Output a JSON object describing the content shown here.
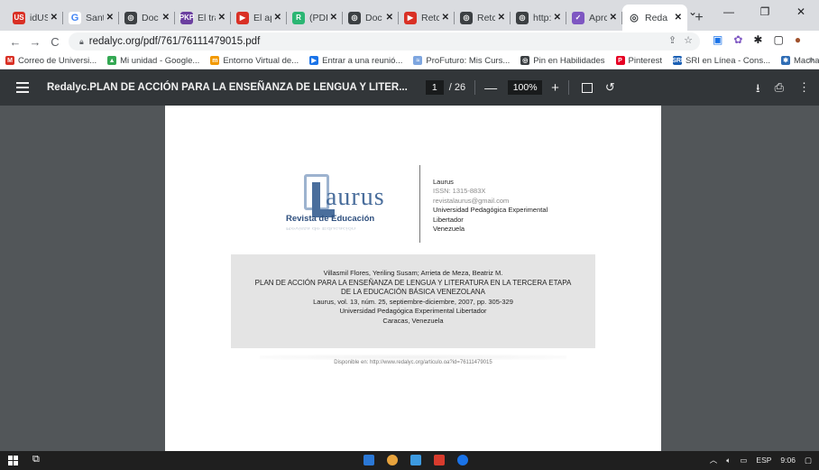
{
  "browser": {
    "tabs": [
      {
        "label": "idUS",
        "favicon_color": "#d93025",
        "favicon_text": "US"
      },
      {
        "label": "Sant",
        "favicon_color": "#ffffff",
        "favicon_text": "G"
      },
      {
        "label": "Doc",
        "favicon_color": "#3c4043",
        "favicon_text": "◎"
      },
      {
        "label": "El tra",
        "favicon_color": "#6b3fa0",
        "favicon_text": "PKP"
      },
      {
        "label": "El ap",
        "favicon_color": "#d93025",
        "favicon_text": "▶"
      },
      {
        "label": "(PDF",
        "favicon_color": "#2bb673",
        "favicon_text": "R"
      },
      {
        "label": "Doc",
        "favicon_color": "#3c4043",
        "favicon_text": "◎"
      },
      {
        "label": "Retc",
        "favicon_color": "#d93025",
        "favicon_text": "▶"
      },
      {
        "label": "Retc",
        "favicon_color": "#3c4043",
        "favicon_text": "◎"
      },
      {
        "label": "http:",
        "favicon_color": "#3c4043",
        "favicon_text": "◎"
      },
      {
        "label": "Aprc",
        "favicon_color": "#7e57c2",
        "favicon_text": "✓"
      }
    ],
    "active_tab": {
      "label": "Reda",
      "favicon_text": "◎"
    },
    "url": "redalyc.org/pdf/761/76111479015.pdf",
    "bookmarks": [
      {
        "label": "Correo de Universi...",
        "color": "#d93025",
        "icon": "M"
      },
      {
        "label": "Mi unidad - Google...",
        "color": "#34a853",
        "icon": "▲"
      },
      {
        "label": "Entorno Virtual de...",
        "color": "#f29900",
        "icon": "m"
      },
      {
        "label": "Entrar a una reunió...",
        "color": "#1a73e8",
        "icon": "▶"
      },
      {
        "label": "ProFuturo: Mis Curs...",
        "color": "#7ea6e0",
        "icon": "≈"
      },
      {
        "label": "Pin en Habilidades",
        "color": "#3c4043",
        "icon": "◎"
      },
      {
        "label": "Pinterest",
        "color": "#e60023",
        "icon": "P"
      },
      {
        "label": "SRI en Línea - Cons...",
        "color": "#1a5fb4",
        "icon": "SRI"
      },
      {
        "label": "Machala Digital",
        "color": "#2f6db5",
        "icon": "✱"
      }
    ]
  },
  "pdf": {
    "title": "Redalyc.PLAN DE ACCIÓN PARA LA ENSEÑANZA DE LENGUA Y LITER...",
    "current_page": "1",
    "total_pages": "/ 26",
    "zoom": "100%"
  },
  "document": {
    "logo_word": "aurus",
    "logo_subtitle": "Revista de Educación",
    "journal": "Laurus",
    "issn": "ISSN: 1315-883X",
    "email": "revistalaurus@gmail.com",
    "university": "Universidad Pedagógica Experimental",
    "university2": "Libertador",
    "country": "Venezuela",
    "authors": "Villasmil Flores, Yeriling Susam; Arrieta de Meza, Beatriz M.",
    "article_title_1": "PLAN DE ACCIÓN PARA LA ENSEÑANZA DE LENGUA Y LITERATURA EN LA TERCERA ETAPA",
    "article_title_2": "DE LA EDUCACIÓN BÁSICA VENEZOLANA",
    "citation": "Laurus, vol. 13, núm. 25, septiembre-diciembre, 2007, pp. 305-329",
    "publisher": "Universidad Pedagógica Experimental Libertador",
    "place": "Caracas, Venezuela",
    "available": "Disponible en: http://www.redalyc.org/articulo.oa?id=76111479015"
  },
  "taskbar": {
    "lang": "ESP",
    "time": "9:06"
  }
}
